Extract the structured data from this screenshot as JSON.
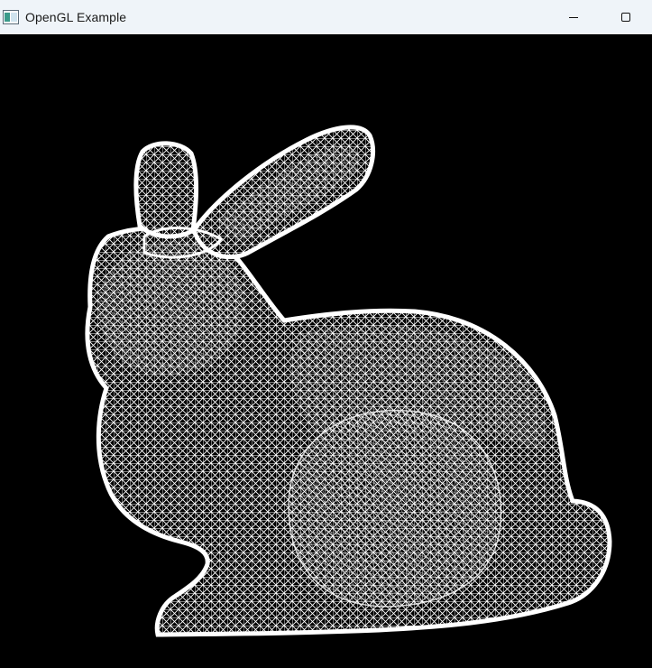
{
  "window": {
    "title": "OpenGL Example",
    "icon": "app-window-icon",
    "controls": {
      "minimize_icon": "minimize-icon",
      "maximize_icon": "maximize-icon"
    }
  },
  "viewport": {
    "background": "#000000",
    "mesh_color": "#ffffff",
    "render_mode": "wireframe",
    "model": "bunny"
  }
}
